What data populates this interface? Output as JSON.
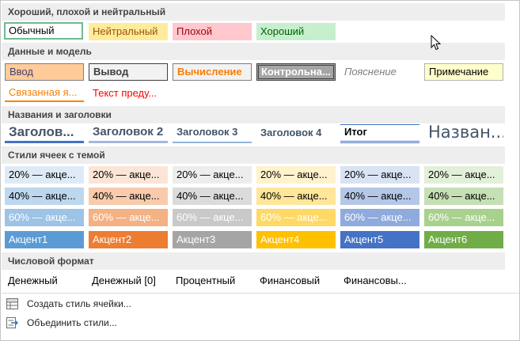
{
  "sections": {
    "good_bad": "Хороший, плохой и нейтральный",
    "data_model": "Данные и модель",
    "titles": "Названия и заголовки",
    "themed": "Стили ячеек с темой",
    "number": "Числовой формат"
  },
  "good_bad": [
    "Обычный",
    "Нейтральный",
    "Плохой",
    "Хороший"
  ],
  "data_model_row1": [
    "Ввод",
    "Вывод",
    "Вычисление",
    "Контрольна...",
    "Пояснение",
    "Примечание"
  ],
  "data_model_row2": [
    "Связанная я...",
    "Текст преду..."
  ],
  "titles": [
    "Заголов...",
    "Заголовок 2",
    "Заголовок 3",
    "Заголовок 4",
    "Итог",
    "Назван..."
  ],
  "themed": {
    "pct20": [
      "20% — акце...",
      "20% — акце...",
      "20% — акце...",
      "20% — акце...",
      "20% — акце...",
      "20% — акце..."
    ],
    "pct40": [
      "40% — акце...",
      "40% — акце...",
      "40% — акце...",
      "40% — акце...",
      "40% — акце...",
      "40% — акце..."
    ],
    "pct60": [
      "60% — акце...",
      "60% — акце...",
      "60% — акце...",
      "60% — акце...",
      "60% — акце...",
      "60% — акце..."
    ],
    "accent": [
      "Акцент1",
      "Акцент2",
      "Акцент3",
      "Акцент4",
      "Акцент5",
      "Акцент6"
    ]
  },
  "number": [
    "Денежный",
    "Денежный [0]",
    "Процентный",
    "Финансовый",
    "Финансовы..."
  ],
  "menu": {
    "new_style": "Создать стиль ячейки...",
    "merge_styles": "Объединить стили..."
  }
}
